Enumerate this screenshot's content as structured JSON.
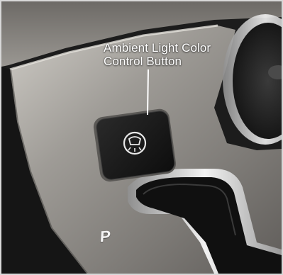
{
  "callout": {
    "line1": "Ambient Light Color",
    "line2": "Control Button"
  },
  "button": {
    "icon": "ambient-light-icon"
  },
  "shifter": {
    "gear_label": "P"
  },
  "colors": {
    "trim": "#8a8783",
    "trim_highlight": "#c9c6c0",
    "interior_dark": "#1b1b1b",
    "button_face": "#151515",
    "chrome": "#d9d9d9"
  }
}
